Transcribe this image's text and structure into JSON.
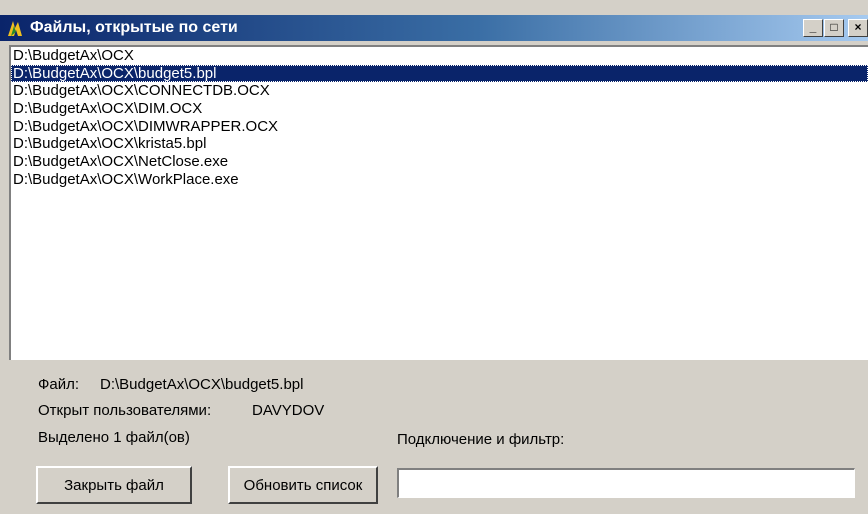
{
  "window": {
    "title": "Файлы, открытые по сети",
    "minimize_glyph": "_",
    "maximize_glyph": "□",
    "close_glyph": "×"
  },
  "file_list": {
    "items": [
      "D:\\BudgetAx\\OCX",
      "D:\\BudgetAx\\OCX\\budget5.bpl",
      "D:\\BudgetAx\\OCX\\CONNECTDB.OCX",
      "D:\\BudgetAx\\OCX\\DIM.OCX",
      "D:\\BudgetAx\\OCX\\DIMWRAPPER.OCX",
      "D:\\BudgetAx\\OCX\\krista5.bpl",
      "D:\\BudgetAx\\OCX\\NetClose.exe",
      "D:\\BudgetAx\\OCX\\WorkPlace.exe"
    ],
    "selected_index": 1
  },
  "info": {
    "file_label": "Файл:",
    "file_value": "D:\\BudgetAx\\OCX\\budget5.bpl",
    "users_label": "Открыт пользователями:",
    "users_value": "DAVYDOV",
    "selected_count_text": "Выделено 1 файл(ов)",
    "filter_label": "Подключение и фильтр:"
  },
  "buttons": {
    "close_file": "Закрыть файл",
    "refresh_list": "Обновить список"
  },
  "filter_input": {
    "value": ""
  },
  "colors": {
    "selection": "#0a246a",
    "face": "#d4d0c8"
  }
}
